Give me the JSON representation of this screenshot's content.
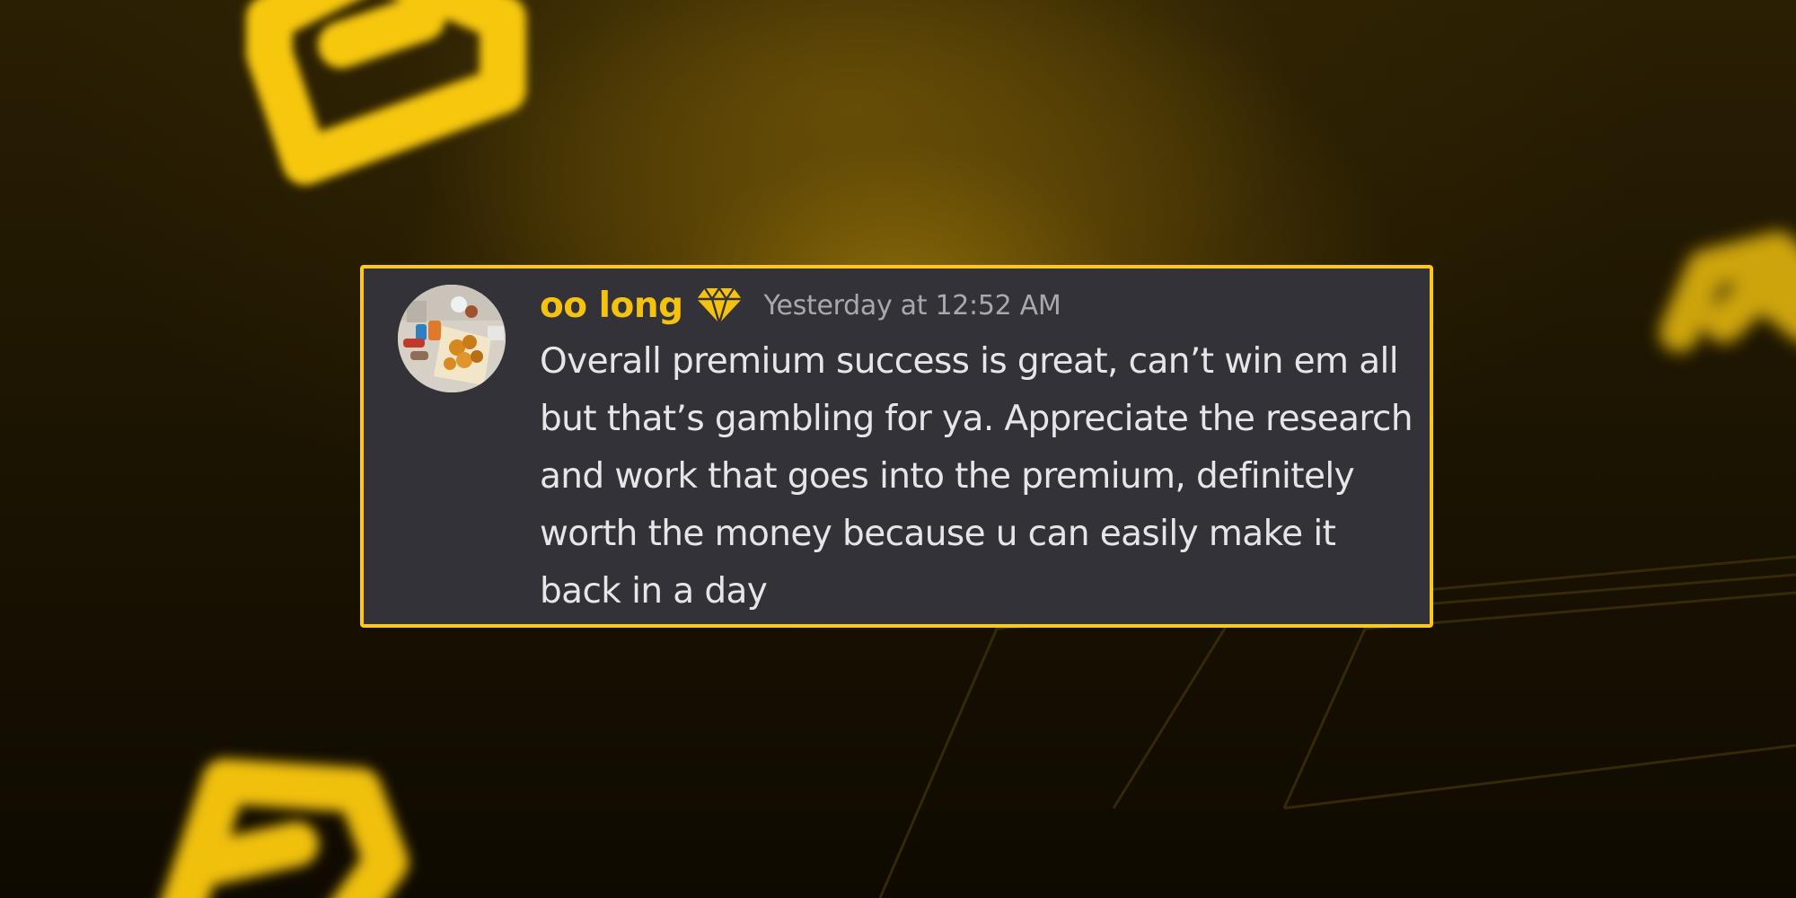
{
  "message": {
    "author": "oo long",
    "author_badge_icon": "diamond-icon",
    "timestamp": "Yesterday at 12:52 AM",
    "text": "Overall premium success is great, can’t win em all but that’s gambling for ya. Appreciate the research and work that goes into the premium, definitely worth the money because u can easily make it back in a day",
    "avatar_icon": "user-avatar-photo"
  },
  "colors": {
    "accent": "#ffc814",
    "username": "#f5c20f",
    "card_background": "#333238",
    "message_text": "#e6e6e8",
    "timestamp_text": "#a7a9ad",
    "background_dark": "#120d02"
  },
  "background": {
    "logo_icon": "brand-logo-icon"
  }
}
